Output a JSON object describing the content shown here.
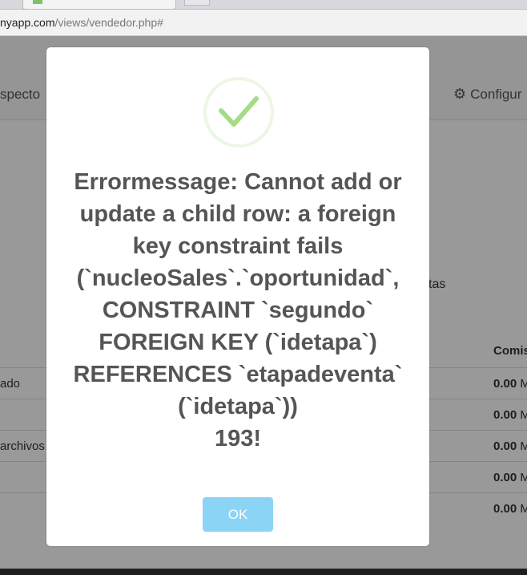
{
  "browser": {
    "url_domain": "nyapp.com",
    "url_path": "/views/vendedor.php#"
  },
  "navbar": {
    "left_item": "specto",
    "right_item": "Configur"
  },
  "page": {
    "partial_text": "tas",
    "column_header": "Comis",
    "rows": [
      {
        "label": "ado",
        "value": "0.00",
        "suffix": "M"
      },
      {
        "label": "",
        "value": "0.00",
        "suffix": "M"
      },
      {
        "label": "archivos",
        "value": "0.00",
        "suffix": "M"
      },
      {
        "label": "",
        "value": "0.00",
        "suffix": "M"
      },
      {
        "label": "",
        "value": "0.00",
        "suffix": "M"
      }
    ]
  },
  "modal": {
    "icon": "success-check-icon",
    "message": "Errormessage: Cannot add or update a child row: a foreign key constraint fails (`nucleoSales`.`oportunidad`, CONSTRAINT `segundo` FOREIGN KEY (`idetapa`) REFERENCES `etapadeventa` (`idetapa`))",
    "code": "193!",
    "ok_label": "OK"
  },
  "colors": {
    "ok_button": "#8cd4f5",
    "success_green": "#a5dc86",
    "message_text": "#555555"
  }
}
